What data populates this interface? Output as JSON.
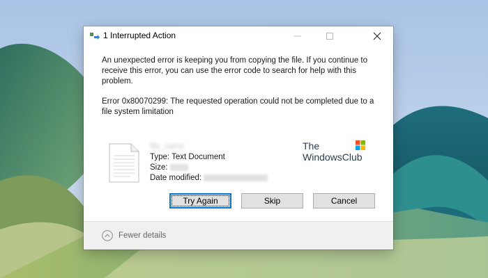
{
  "window": {
    "title": "1 Interrupted Action",
    "icon": "copy-transfer-icon"
  },
  "dialog": {
    "message": "An unexpected error is keeping you from copying the file. If you continue to receive this error, you can use the error code to search for help with this problem.",
    "error_text": "Error 0x80070299: The requested operation could not be completed due to a file system limitation"
  },
  "file": {
    "name": "file_name",
    "type_label": "Type: Text Document",
    "size_label": "Size:",
    "date_label": "Date modified:"
  },
  "watermark": {
    "line1": "The",
    "line2": "WindowsClub"
  },
  "buttons": {
    "try_again": "Try Again",
    "skip": "Skip",
    "cancel": "Cancel"
  },
  "footer": {
    "details_label": "Fewer details"
  },
  "colors": {
    "accent": "#0078d7",
    "footer_bg": "#f0f0f0"
  }
}
